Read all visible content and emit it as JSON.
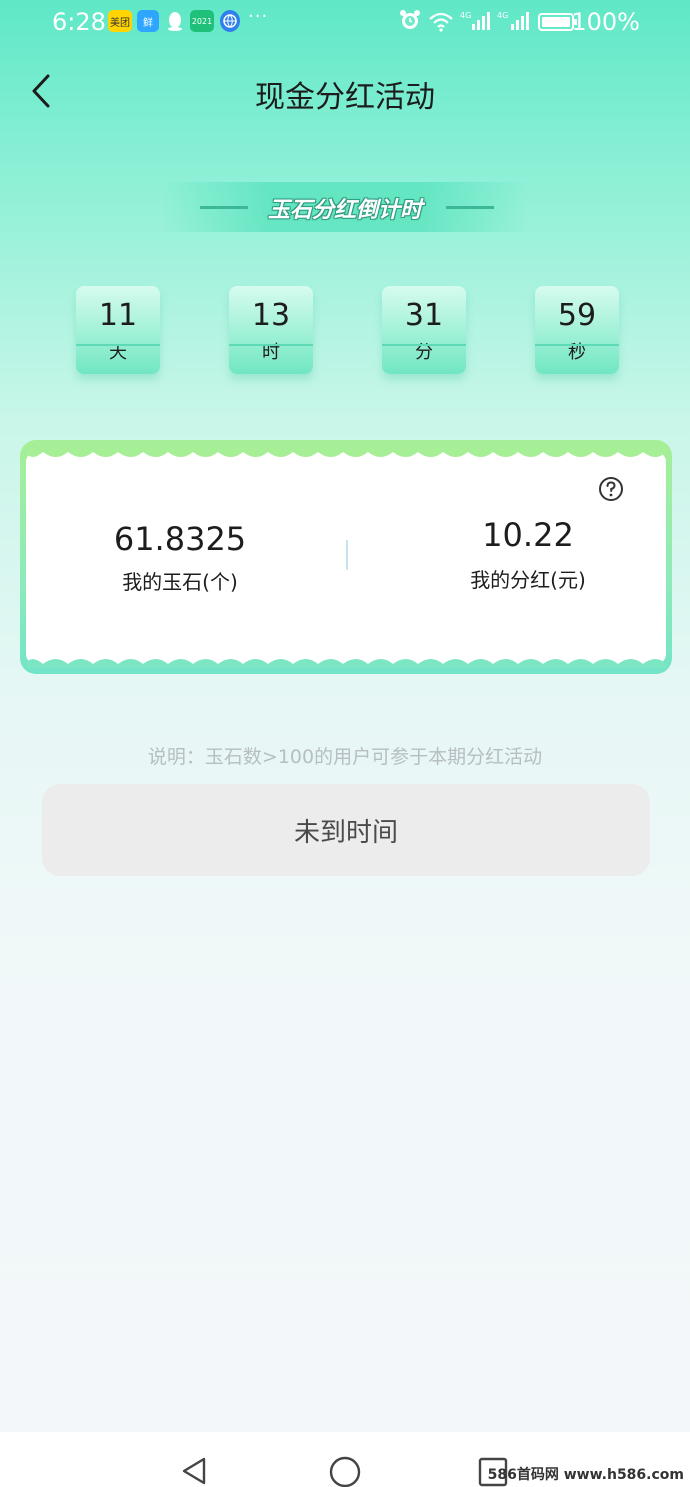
{
  "status_bar": {
    "time": "6:28",
    "notification_icons": [
      "美团",
      "鲜",
      "qq-icon",
      "2021",
      "browser-icon"
    ],
    "more": "···",
    "battery": "100%"
  },
  "header": {
    "title": "现金分红活动"
  },
  "countdown": {
    "title": "玉石分红倒计时",
    "items": [
      {
        "value": "11",
        "unit": "天"
      },
      {
        "value": "13",
        "unit": "时"
      },
      {
        "value": "31",
        "unit": "分"
      },
      {
        "value": "59",
        "unit": "秒"
      }
    ]
  },
  "stats": {
    "jade_value": "61.8325",
    "jade_label": "我的玉石(个)",
    "dividend_value": "10.22",
    "dividend_label": "我的分红(元)"
  },
  "note": "说明：玉石数>100的用户可参于本期分红活动",
  "action_button": "未到时间",
  "watermark": "586首码网 www.h586.com",
  "colors": {
    "accent": "#5fe8c6",
    "card_border": "#8eeaba",
    "button_bg": "#ececec"
  }
}
